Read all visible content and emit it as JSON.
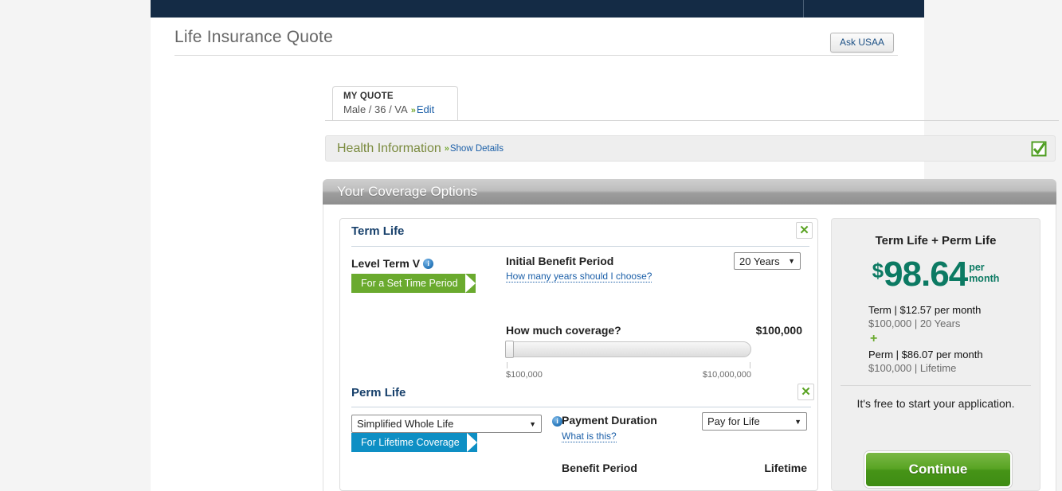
{
  "header": {
    "page_title": "Life Insurance Quote",
    "ask_button": "Ask USAA"
  },
  "quote_tab": {
    "label": "MY QUOTE",
    "summary": "Male / 36 / VA",
    "chevron": "»",
    "edit_link": "Edit"
  },
  "health": {
    "title": "Health Information",
    "chevron": "»",
    "show_details": "Show Details",
    "status_icon": "green-check-icon"
  },
  "coverage": {
    "section_title": "Your Coverage Options",
    "term": {
      "heading": "Term Life",
      "close_icon": "green-x-icon",
      "product_name": "Level Term V",
      "info_icon": "info-icon",
      "ribbon": "For a Set Time Period",
      "benefit_label": "Initial Benefit Period",
      "benefit_help": "How many years should I choose?",
      "benefit_value": "20 Years",
      "coverage_question": "How much coverage?",
      "coverage_value": "$100,000",
      "slider_min": "$100,000",
      "slider_max": "$10,000,000",
      "slider_position_pct": 2
    },
    "perm": {
      "heading": "Perm Life",
      "close_icon": "green-x-icon",
      "product_value": "Simplified Whole Life",
      "info_icon": "info-icon",
      "ribbon": "For Lifetime Coverage",
      "payment_label": "Payment Duration",
      "payment_help": "What is this?",
      "payment_value": "Pay for Life",
      "benefit_period_label": "Benefit Period",
      "benefit_period_value": "Lifetime"
    }
  },
  "summary": {
    "title": "Term Life + Perm Life",
    "currency_symbol": "$",
    "total_amount": "98.64",
    "per_line1": "per",
    "per_line2": "month",
    "term_line1": "Term | $12.57   per month",
    "term_line2": "$100,000   |   20 Years",
    "plus_symbol": "+",
    "perm_line1": "Perm | $86.07   per month",
    "perm_line2": "$100,000   |   Lifetime",
    "free_text": "It's free to start your application.",
    "continue_label": "Continue"
  },
  "colors": {
    "navy": "#142b45",
    "teal": "#0c7a63",
    "green": "#6aaa2e",
    "blue_ribbon": "#0e8fc4",
    "link_blue": "#1b5fa8",
    "olive": "#7b8b3f"
  }
}
